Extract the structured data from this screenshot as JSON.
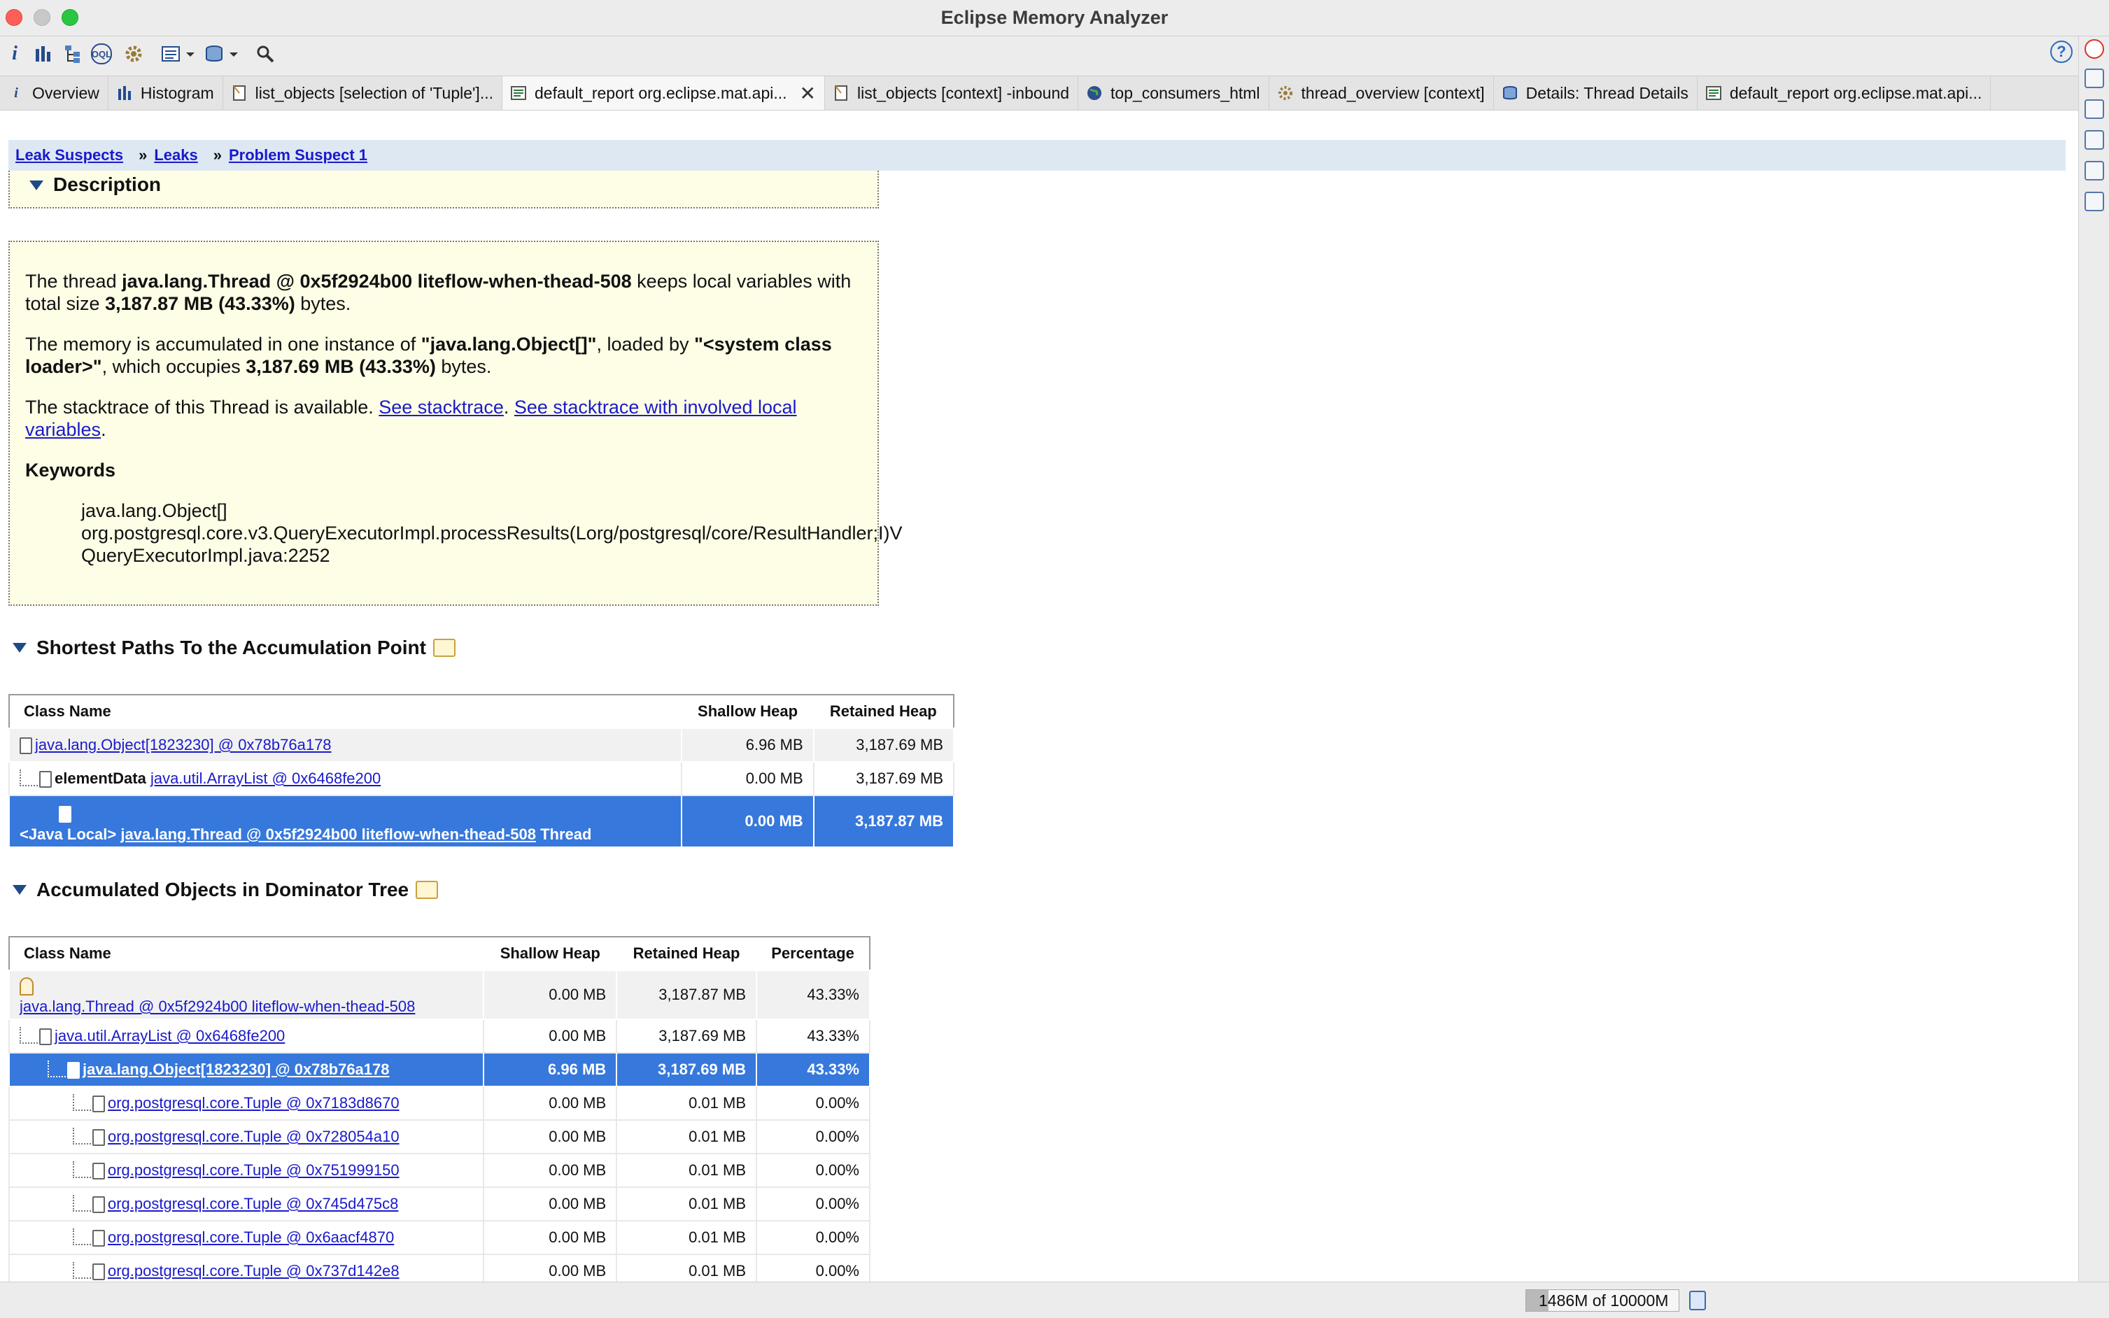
{
  "window": {
    "title": "Eclipse Memory Analyzer"
  },
  "toolbar": {
    "icons": [
      "info-icon",
      "histogram-icon",
      "dominator-tree-icon",
      "oql-icon",
      "thread-overview-icon",
      "query-browser-icon",
      "heap-dump-overview-icon",
      "search-icon"
    ],
    "info_label": "i",
    "oql_label": "OQL"
  },
  "tabs": [
    {
      "label": "Overview",
      "icon": "info-icon"
    },
    {
      "label": "Histogram",
      "icon": "histogram-icon"
    },
    {
      "label": "list_objects  [selection of 'Tuple']...",
      "icon": "list-icon"
    },
    {
      "label": "default_report  org.eclipse.mat.api...",
      "icon": "report-icon",
      "active": true
    },
    {
      "label": "list_objects  [context] -inbound",
      "icon": "list-icon"
    },
    {
      "label": "top_consumers_html",
      "icon": "globe-icon"
    },
    {
      "label": "thread_overview  [context]",
      "icon": "gear-icon"
    },
    {
      "label": "Details: Thread Details",
      "icon": "database-icon"
    },
    {
      "label": "default_report  org.eclipse.mat.api...",
      "icon": "report-icon"
    }
  ],
  "breadcrumb": {
    "item1": "Leak Suspects",
    "item2": "Leaks",
    "item3": "Problem Suspect 1",
    "sep": "»"
  },
  "description": {
    "title": "Description",
    "p1_a": "The thread ",
    "p1_b": "java.lang.Thread @ 0x5f2924b00 liteflow-when-thead-508",
    "p1_c": " keeps local variables with total size ",
    "p1_d": "3,187.87 MB (43.33%)",
    "p1_e": " bytes.",
    "p2_a": "The memory is accumulated in one instance of ",
    "p2_b": "\"java.lang.Object[]\"",
    "p2_c": ", loaded by ",
    "p2_d": "\"<system class loader>\"",
    "p2_e": ", which occupies ",
    "p2_f": "3,187.69 MB (43.33%)",
    "p2_g": " bytes.",
    "p3_a": "The stacktrace of this Thread is available. ",
    "p3_link1": "See stacktrace",
    "p3_b": ". ",
    "p3_link2": "See stacktrace with involved local variables",
    "p3_c": ".",
    "keywords_title": "Keywords",
    "keywords": [
      "java.lang.Object[]",
      "org.postgresql.core.v3.QueryExecutorImpl.processResults(Lorg/postgresql/core/ResultHandler;I)V",
      "QueryExecutorImpl.java:2252"
    ]
  },
  "shortest_paths": {
    "title": "Shortest Paths To the Accumulation Point",
    "headers": [
      "Class Name",
      "Shallow Heap",
      "Retained Heap"
    ],
    "rows": [
      {
        "link": "java.lang.Object[1823230] @ 0x78b76a178",
        "shallow": "6.96 MB",
        "retained": "3,187.69 MB"
      },
      {
        "prefix": "elementData ",
        "link": "java.util.ArrayList @ 0x6468fe200",
        "shallow": "0.00 MB",
        "retained": "3,187.69 MB"
      },
      {
        "prefix": "<Java Local> ",
        "link": "java.lang.Thread @ 0x5f2924b00 liteflow-when-thead-508",
        "suffix": " Thread",
        "shallow": "0.00 MB",
        "retained": "3,187.87 MB"
      }
    ]
  },
  "dominator": {
    "title": "Accumulated Objects in Dominator Tree",
    "headers": [
      "Class Name",
      "Shallow Heap",
      "Retained Heap",
      "Percentage"
    ],
    "rows": [
      {
        "link": "java.lang.Thread @ 0x5f2924b00 liteflow-when-thead-508",
        "shallow": "0.00 MB",
        "retained": "3,187.87 MB",
        "pct": "43.33%"
      },
      {
        "link": "java.util.ArrayList @ 0x6468fe200",
        "shallow": "0.00 MB",
        "retained": "3,187.69 MB",
        "pct": "43.33%"
      },
      {
        "link": "java.lang.Object[1823230] @ 0x78b76a178",
        "shallow": "6.96 MB",
        "retained": "3,187.69 MB",
        "pct": "43.33%"
      },
      {
        "link": "org.postgresql.core.Tuple @ 0x7183d8670",
        "shallow": "0.00 MB",
        "retained": "0.01 MB",
        "pct": "0.00%"
      },
      {
        "link": "org.postgresql.core.Tuple @ 0x728054a10",
        "shallow": "0.00 MB",
        "retained": "0.01 MB",
        "pct": "0.00%"
      },
      {
        "link": "org.postgresql.core.Tuple @ 0x751999150",
        "shallow": "0.00 MB",
        "retained": "0.01 MB",
        "pct": "0.00%"
      },
      {
        "link": "org.postgresql.core.Tuple @ 0x745d475c8",
        "shallow": "0.00 MB",
        "retained": "0.01 MB",
        "pct": "0.00%"
      },
      {
        "link": "org.postgresql.core.Tuple @ 0x6aacf4870",
        "shallow": "0.00 MB",
        "retained": "0.01 MB",
        "pct": "0.00%"
      },
      {
        "link": "org.postgresql.core.Tuple @ 0x737d142e8",
        "shallow": "0.00 MB",
        "retained": "0.01 MB",
        "pct": "0.00%"
      }
    ]
  },
  "status": {
    "heap": "1486M of 10000M",
    "heap_fraction": 0.1486
  }
}
